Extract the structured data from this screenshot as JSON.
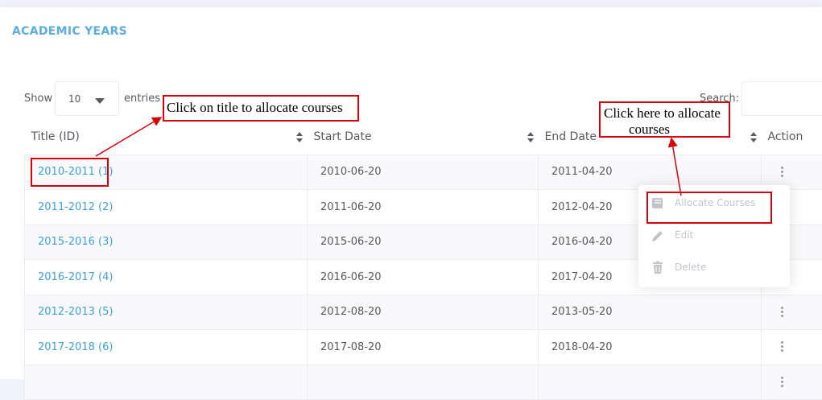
{
  "page": {
    "title": "ACADEMIC YEARS"
  },
  "table_controls": {
    "show_label": "Show",
    "entries_value": "10",
    "entries_label": "entries",
    "search_label": "Search:",
    "search_value": ""
  },
  "table": {
    "columns": [
      "Title (ID)",
      "Start Date",
      "End Date",
      "Action"
    ],
    "rows": [
      {
        "title": "2010-2011 (1)",
        "start": "2010-06-20",
        "end": "2011-04-20"
      },
      {
        "title": "2011-2012 (2)",
        "start": "2011-06-20",
        "end": "2012-04-20"
      },
      {
        "title": "2015-2016 (3)",
        "start": "2015-06-20",
        "end": "2016-04-20"
      },
      {
        "title": "2016-2017 (4)",
        "start": "2016-06-20",
        "end": "2017-04-20"
      },
      {
        "title": "2012-2013 (5)",
        "start": "2012-08-20",
        "end": "2013-05-20"
      },
      {
        "title": "2017-2018 (6)",
        "start": "2017-08-20",
        "end": "2018-04-20"
      }
    ]
  },
  "action_menu": {
    "items": [
      {
        "label": "Allocate Courses",
        "icon": "book-icon"
      },
      {
        "label": "Edit",
        "icon": "pencil-icon"
      },
      {
        "label": "Delete",
        "icon": "trash-icon"
      }
    ]
  },
  "annotations": {
    "title_callout": "Click on title to allocate courses",
    "allocate_callout_line1": "Click here to allocate",
    "allocate_callout_line2": "courses",
    "color": "#d9000b"
  },
  "colors": {
    "accent": "#5dade2",
    "link": "#3ea1db",
    "annotation_red": "#d9000b",
    "menu_text": "#c2c4cc"
  }
}
